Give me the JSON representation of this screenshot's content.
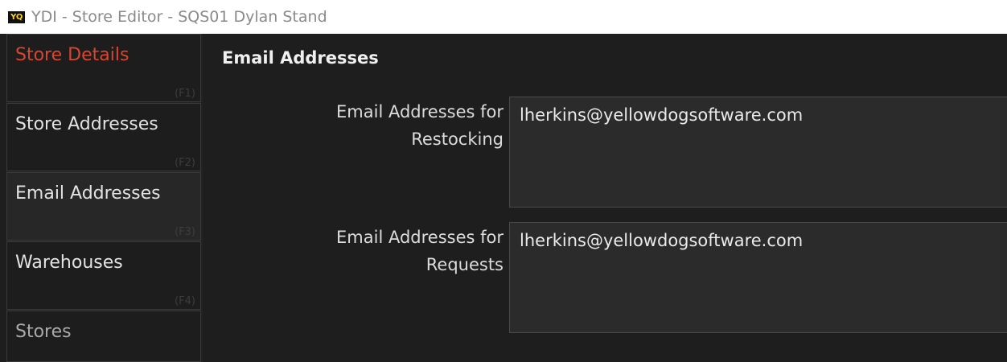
{
  "window": {
    "logo_text": "YQ",
    "title": "YDI - Store Editor - SQS01 Dylan Stand"
  },
  "sidebar": {
    "items": [
      {
        "label": "Store Details",
        "key": "(F1)"
      },
      {
        "label": "Store Addresses",
        "key": "(F2)"
      },
      {
        "label": "Email Addresses",
        "key": "(F3)"
      },
      {
        "label": "Warehouses",
        "key": "(F4)"
      },
      {
        "label": "Stores",
        "key": ""
      }
    ]
  },
  "main": {
    "section_title": "Email Addresses",
    "fields": [
      {
        "label_line1": "Email Addresses for",
        "label_line2": "Restocking",
        "value": "lherkins@yellowdogsoftware.com"
      },
      {
        "label_line1": "Email Addresses for",
        "label_line2": "Requests",
        "value": "lherkins@yellowdogsoftware.com"
      }
    ]
  },
  "colors": {
    "background": "#1e1e1e",
    "accent_red": "#d9462e",
    "text": "#e2e2e2",
    "field_background": "#2b2b2b"
  }
}
